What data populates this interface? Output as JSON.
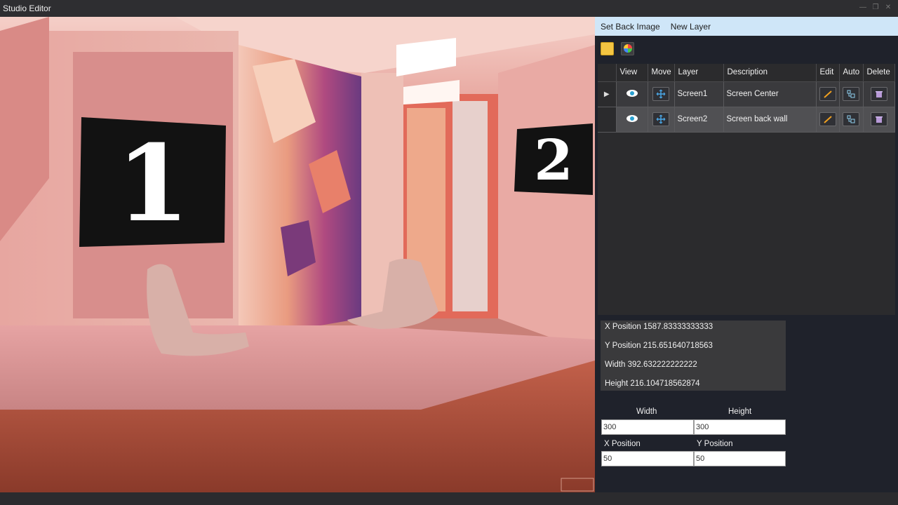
{
  "window": {
    "title": "Studio Editor"
  },
  "menu": {
    "set_back_image": "Set Back Image",
    "new_layer": "New Layer"
  },
  "toolbar": {
    "folder_icon": "folder-icon",
    "color_icon": "color-wheel-icon"
  },
  "grid": {
    "headers": [
      "View",
      "Move",
      "Layer",
      "Description",
      "Edit",
      "Auto",
      "Delete"
    ],
    "rows": [
      {
        "layer": "Screen1",
        "description": "Screen Center",
        "selected": true
      },
      {
        "layer": "Screen2",
        "description": "Screen back wall",
        "selected": false
      }
    ]
  },
  "info": {
    "x_position": "X Position 1587.83333333333",
    "y_position": "Y Position 215.651640718563",
    "width": "Width 392.632222222222",
    "height": "Height 216.104718562874"
  },
  "form": {
    "width_label": "Width",
    "height_label": "Height",
    "width_value": "300",
    "height_value": "300",
    "x_label": "X Position",
    "y_label": "Y Position",
    "x_value": "50",
    "y_value": "50"
  },
  "scene": {
    "screen1_number": "1",
    "screen2_number": "2"
  },
  "colors": {
    "menu_bg": "#cfe6f8",
    "panel_bg": "#1f222b",
    "accent_edit": "#f0a020",
    "accent_move": "#4aa8e8"
  }
}
